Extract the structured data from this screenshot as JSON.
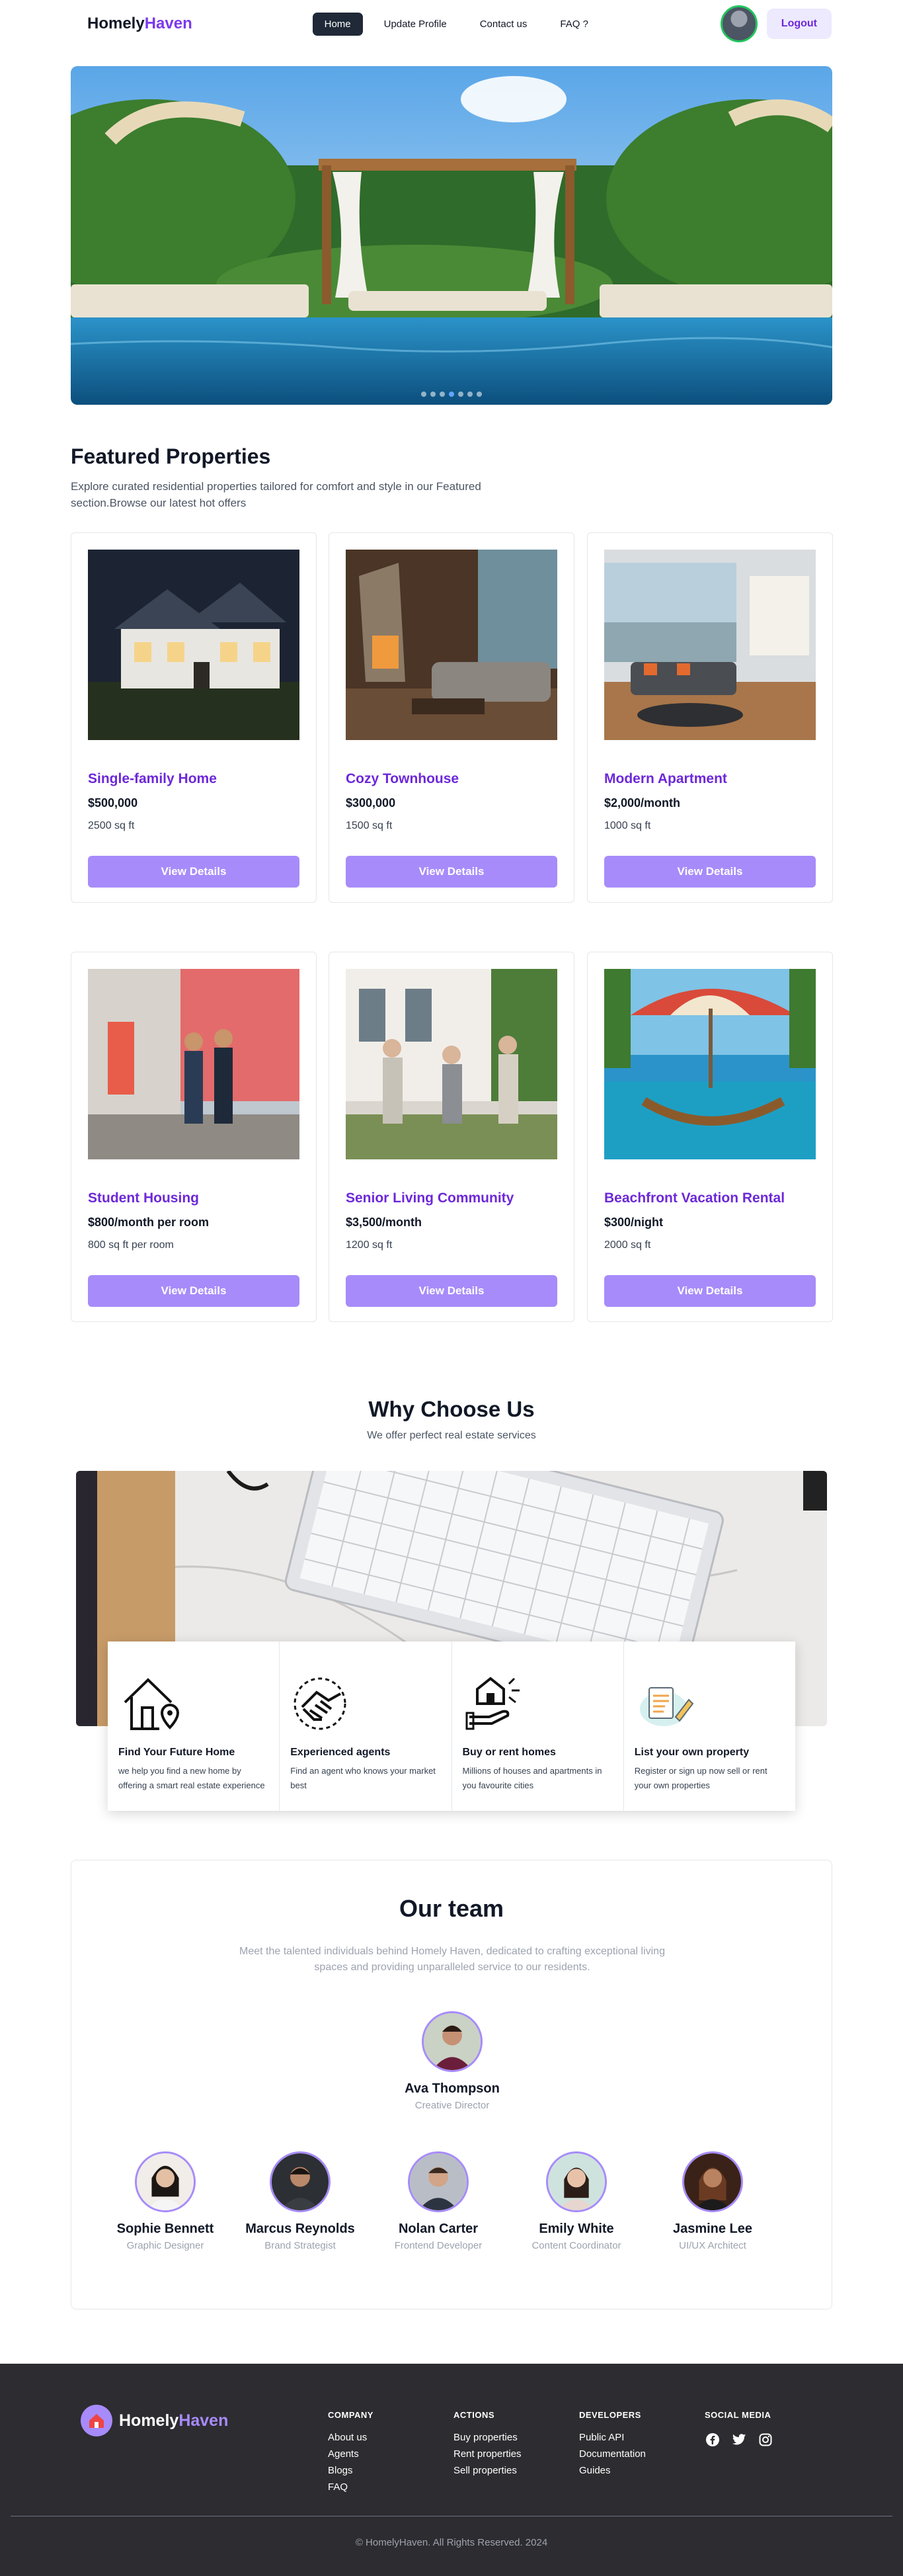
{
  "nav": {
    "brand_main": "Homely",
    "brand_accent": "Haven",
    "links": [
      "Home",
      "Update Profile",
      "Contact us",
      "FAQ ?"
    ],
    "logout": "Logout"
  },
  "hero": {
    "slides": 7,
    "active_slide": 4
  },
  "featured": {
    "title": "Featured Properties",
    "description": "Explore curated residential properties tailored for comfort and style in our Featured section.Browse our latest hot offers",
    "button_label": "View Details",
    "properties": [
      {
        "title": "Single-family Home",
        "price": "$500,000",
        "size": "2500 sq ft",
        "image": "house-at-night"
      },
      {
        "title": "Cozy Townhouse",
        "price": "$300,000",
        "size": "1500 sq ft",
        "image": "living-room-fireplace"
      },
      {
        "title": "Modern Apartment",
        "price": "$2,000/month",
        "size": "1000 sq ft",
        "image": "apartment-interior"
      },
      {
        "title": "Student Housing",
        "price": "$800/month per room",
        "size": "800 sq ft per room",
        "image": "students-outside"
      },
      {
        "title": "Senior Living Community",
        "price": "$3,500/month",
        "size": "1200 sq ft",
        "image": "seniors-porch"
      },
      {
        "title": "Beachfront Vacation Rental",
        "price": "$300/night",
        "size": "2000 sq ft",
        "image": "beach-hammock"
      }
    ]
  },
  "why": {
    "title": "Why Choose Us",
    "subtitle": "We offer perfect real estate services",
    "features": [
      {
        "icon": "house-location-icon",
        "title": "Find Your Future Home",
        "desc": "we help you find a new home by offering a smart real estate experience"
      },
      {
        "icon": "handshake-icon",
        "title": "Experienced agents",
        "desc": "Find an agent who knows your market best"
      },
      {
        "icon": "buy-house-icon",
        "title": "Buy or rent homes",
        "desc": "Millions of houses and apartments in you favourite cities"
      },
      {
        "icon": "document-pen-icon",
        "title": "List your own property",
        "desc": "Register or sign up now sell or rent your own properties"
      }
    ]
  },
  "team": {
    "title": "Our team",
    "lead": "Meet the talented individuals behind Homely Haven, dedicated to crafting exceptional living spaces and providing unparalleled service to our residents.",
    "director": {
      "name": "Ava Thompson",
      "role": "Creative Director"
    },
    "members": [
      {
        "name": "Sophie Bennett",
        "role": "Graphic Designer"
      },
      {
        "name": "Marcus Reynolds",
        "role": "Brand Strategist"
      },
      {
        "name": "Nolan Carter",
        "role": "Frontend Developer"
      },
      {
        "name": "Emily White",
        "role": "Content Coordinator"
      },
      {
        "name": "Jasmine Lee",
        "role": "UI/UX Architect"
      }
    ]
  },
  "footer": {
    "brand_main": "Homely",
    "brand_accent": "Haven",
    "columns": [
      {
        "title": "COMPANY",
        "links": [
          "About us",
          "Agents",
          "Blogs",
          "FAQ"
        ]
      },
      {
        "title": "ACTIONS",
        "links": [
          "Buy properties",
          "Rent properties",
          "Sell properties"
        ]
      },
      {
        "title": "DEVELOPERS",
        "links": [
          "Public API",
          "Documentation",
          "Guides"
        ]
      }
    ],
    "social_title": "SOCIAL MEDIA",
    "socials": [
      "facebook-icon",
      "twitter-icon",
      "instagram-icon"
    ],
    "copyright": "© HomelyHaven. All Rights Reserved. 2024"
  },
  "colors": {
    "accent": "#7c3aed",
    "button": "#a78bfa",
    "footer_bg": "#2d2c30"
  }
}
